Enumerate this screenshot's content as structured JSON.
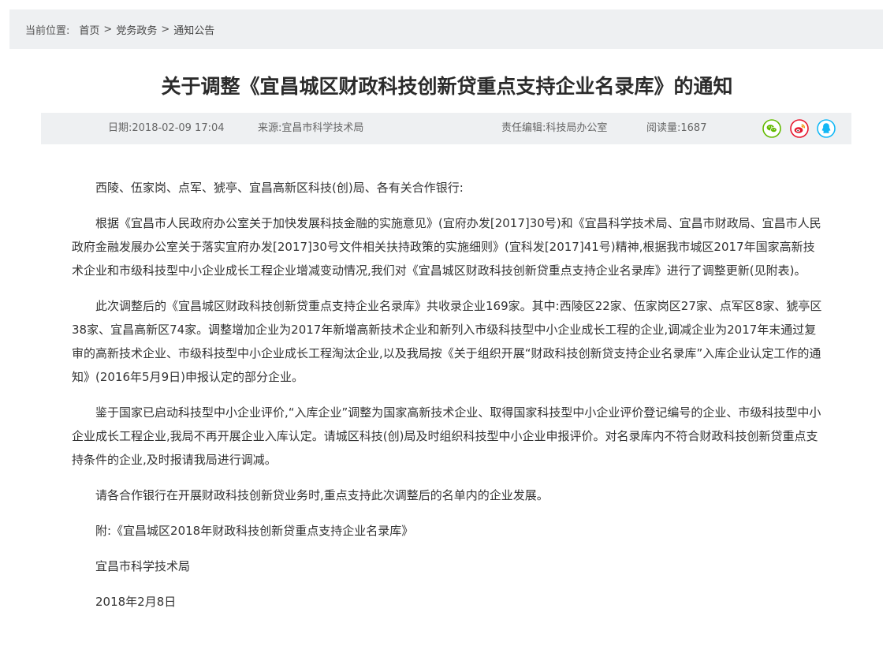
{
  "breadcrumb": {
    "label": "当前位置:",
    "items": [
      "首页",
      "党务政务",
      "通知公告"
    ],
    "separator": ">"
  },
  "article": {
    "title": "关于调整《宜昌城区财政科技创新贷重点支持企业名录库》的通知",
    "meta": {
      "date": "日期:2018-02-09 17:04",
      "source": "来源:宜昌市科学技术局",
      "editor": "责任编辑:科技局办公室",
      "views": "阅读量:1687"
    },
    "share_icons": [
      "wechat-icon",
      "weibo-icon",
      "qq-icon"
    ],
    "share_colors": {
      "wechat": "#62b900",
      "weibo": "#e6162d",
      "qq": "#12b7f5"
    },
    "paragraphs": [
      "西陵、伍家岗、点军、猇亭、宜昌高新区科技(创)局、各有关合作银行:",
      "根据《宜昌市人民政府办公室关于加快发展科技金融的实施意见》(宜府办发[2017]30号)和《宜昌科学技术局、宜昌市财政局、宜昌市人民政府金融发展办公室关于落实宜府办发[2017]30号文件相关扶持政策的实施细则》(宜科发[2017]41号)精神,根据我市城区2017年国家高新技术企业和市级科技型中小企业成长工程企业增减变动情况,我们对《宜昌城区财政科技创新贷重点支持企业名录库》进行了调整更新(见附表)。",
      "此次调整后的《宜昌城区财政科技创新贷重点支持企业名录库》共收录企业169家。其中:西陵区22家、伍家岗区27家、点军区8家、猇亭区38家、宜昌高新区74家。调整增加企业为2017年新增高新技术企业和新列入市级科技型中小企业成长工程的企业,调减企业为2017年末通过复审的高新技术企业、市级科技型中小企业成长工程淘汰企业,以及我局按《关于组织开展“财政科技创新贷支持企业名录库”入库企业认定工作的通知》(2016年5月9日)申报认定的部分企业。",
      "鉴于国家已启动科技型中小企业评价,“入库企业”调整为国家高新技术企业、取得国家科技型中小企业评价登记编号的企业、市级科技型中小企业成长工程企业,我局不再开展企业入库认定。请城区科技(创)局及时组织科技型中小企业申报评价。对名录库内不符合财政科技创新贷重点支持条件的企业,及时报请我局进行调减。",
      "请各合作银行在开展财政科技创新贷业务时,重点支持此次调整后的名单内的企业发展。",
      "附:《宜昌城区2018年财政科技创新贷重点支持企业名录库》",
      "宜昌市科学技术局",
      "2018年2月8日"
    ]
  }
}
